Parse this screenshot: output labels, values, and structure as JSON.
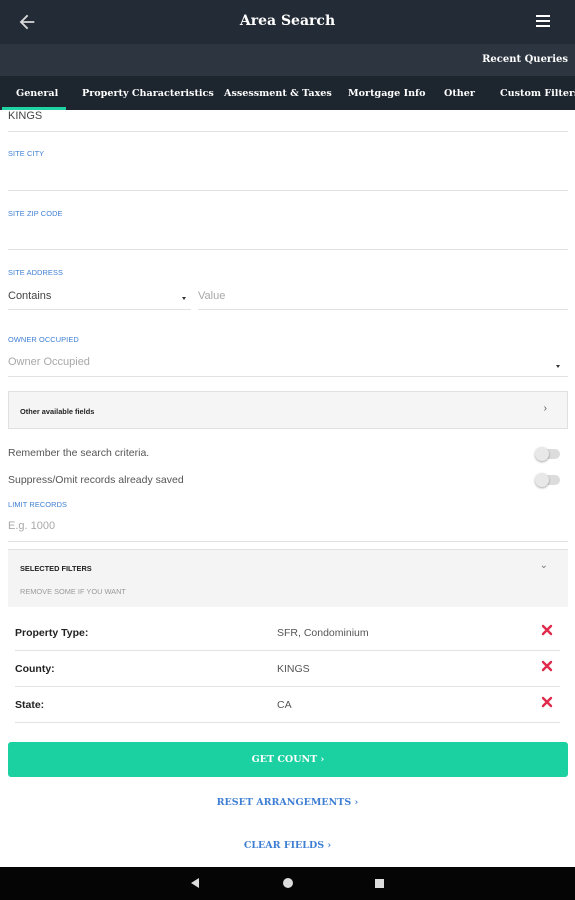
{
  "header": {
    "title": "Area Search",
    "recent_queries": "Recent Queries"
  },
  "tabs": [
    {
      "label": "General",
      "active": true
    },
    {
      "label": "Property Characteristics"
    },
    {
      "label": "Assessment & Taxes"
    },
    {
      "label": "Mortgage Info"
    },
    {
      "label": "Other"
    },
    {
      "label": "Custom Filters"
    }
  ],
  "form": {
    "county_value": "KINGS",
    "site_city_label": "SITE CITY",
    "site_zip_label": "SITE ZIP CODE",
    "site_address_label": "SITE ADDRESS",
    "site_address_operator": "Contains",
    "site_address_placeholder": "Value",
    "owner_occupied_label": "OWNER OCCUPIED",
    "owner_occupied_placeholder": "Owner Occupied",
    "other_fields_label": "Other available fields",
    "remember_label": "Remember the search criteria.",
    "suppress_label": "Suppress/Omit records already saved",
    "limit_label": "LIMIT RECORDS",
    "limit_placeholder": "E.g. 1000"
  },
  "selected_filters": {
    "title": "SELECTED FILTERS",
    "subtitle": "REMOVE SOME IF YOU WANT",
    "rows": [
      {
        "key": "Property Type:",
        "value": "SFR, Condominium"
      },
      {
        "key": "County:",
        "value": "KINGS"
      },
      {
        "key": "State:",
        "value": "CA"
      }
    ]
  },
  "actions": {
    "get_count": "GET COUNT ›",
    "reset": "RESET ARRANGEMENTS ›",
    "clear": "CLEAR FIELDS ›"
  },
  "colors": {
    "accent": "#1cd1a1",
    "link": "#3f7fd3",
    "remove": "#e0294a",
    "appbar": "#232b36"
  }
}
